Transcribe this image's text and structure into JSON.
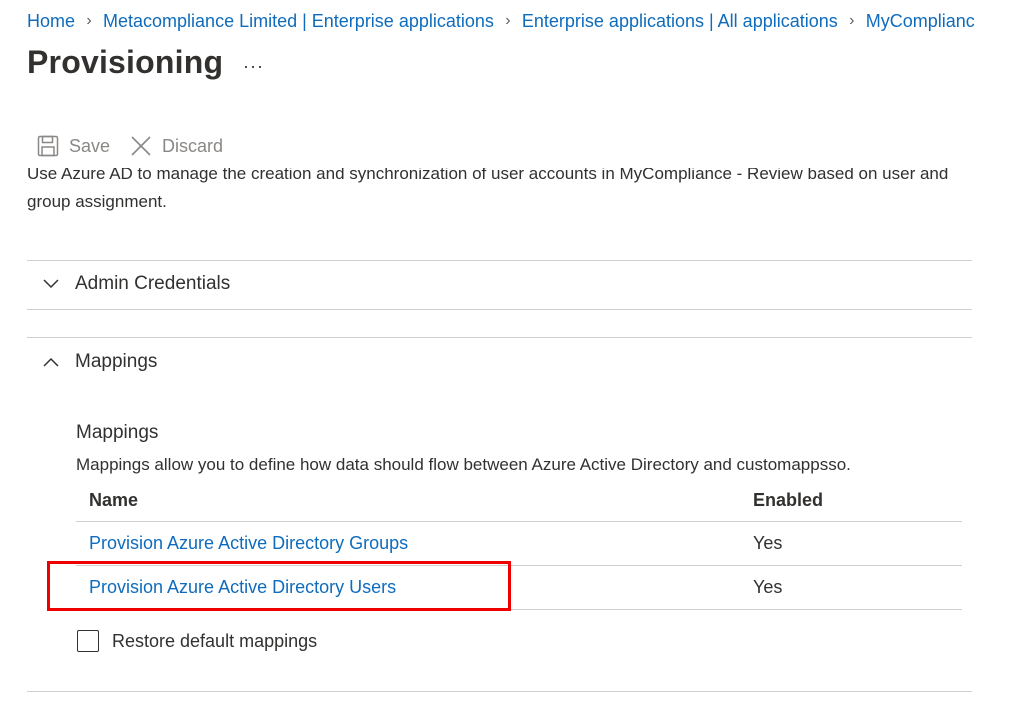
{
  "breadcrumb": [
    {
      "label": "Home"
    },
    {
      "label": "Metacompliance Limited | Enterprise applications"
    },
    {
      "label": "Enterprise applications | All applications"
    },
    {
      "label": "MyComplianc"
    }
  ],
  "page": {
    "title": "Provisioning",
    "more_label": "···"
  },
  "toolbar": {
    "save_label": "Save",
    "discard_label": "Discard",
    "save_icon": "save-icon",
    "discard_icon": "close-icon"
  },
  "description": "Use Azure AD to manage the creation and synchronization of user accounts in MyCompliance - Review based on user and group assignment.",
  "sections": {
    "admin_credentials": {
      "label": "Admin Credentials",
      "expanded": false
    },
    "mappings": {
      "label": "Mappings",
      "expanded": true
    }
  },
  "mappings": {
    "title": "Mappings",
    "description": "Mappings allow you to define how data should flow between Azure Active Directory and customappsso.",
    "columns": [
      "Name",
      "Enabled"
    ],
    "rows": [
      {
        "name": "Provision Azure Active Directory Groups",
        "enabled": "Yes"
      },
      {
        "name": "Provision Azure Active Directory Users",
        "enabled": "Yes"
      }
    ],
    "restore_label": "Restore default mappings",
    "restore_checked": false
  },
  "colors": {
    "link": "#0f6cbd",
    "highlight": "#ee0000",
    "text": "#323130",
    "disabled": "#8a8886"
  }
}
